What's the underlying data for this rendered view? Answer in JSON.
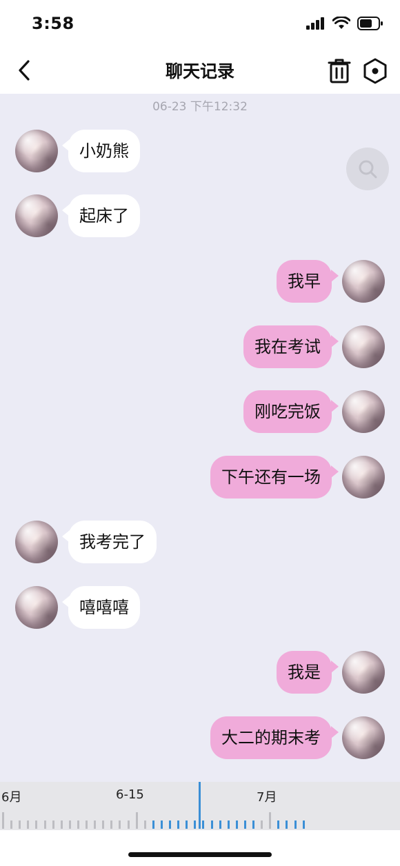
{
  "status_bar": {
    "time": "3:58"
  },
  "header": {
    "title": "聊天记录"
  },
  "chat": {
    "timestamp": "06-23 下午12:32",
    "messages": [
      {
        "side": "left",
        "text": "小奶熊"
      },
      {
        "side": "left",
        "text": "起床了"
      },
      {
        "side": "right",
        "text": "我早"
      },
      {
        "side": "right",
        "text": "我在考试"
      },
      {
        "side": "right",
        "text": "刚吃完饭"
      },
      {
        "side": "right",
        "text": "下午还有一场"
      },
      {
        "side": "left",
        "text": "我考完了"
      },
      {
        "side": "left",
        "text": "嘻嘻嘻"
      },
      {
        "side": "right",
        "text": "我是"
      },
      {
        "side": "right",
        "text": "大二的期末考"
      }
    ]
  },
  "timeline": {
    "labels": [
      "6月",
      "6-15",
      "7月"
    ]
  },
  "colors": {
    "background": "#EBEBF5",
    "sent_bubble": "#F0ABDA",
    "received_bubble": "#FFFFFF",
    "timeline_accent": "#3B8FD6"
  }
}
